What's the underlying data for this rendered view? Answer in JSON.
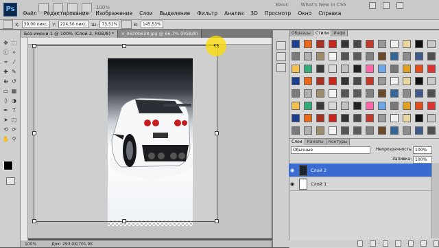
{
  "app": {
    "logo": "Ps",
    "zoom_display": "100%",
    "workspace_items": [
      "Basic",
      "What's New in CS5"
    ]
  },
  "menu": [
    "Файл",
    "Редактирование",
    "Изображение",
    "Слои",
    "Выделение",
    "Фильтр",
    "Анализ",
    "3D",
    "Просмотр",
    "Окно",
    "Справка"
  ],
  "options": {
    "x_label": "X:",
    "x_value": "39,00 пикс.",
    "y_label": "Y:",
    "y_value": "224,50 пикс.",
    "w_label": "Ш:",
    "w_value": "73,51%",
    "h_label": "В:",
    "h_value": "145,53%"
  },
  "tabs": [
    {
      "label": "Без имени-1 @ 100% (Слой 2, RGB/8) *",
      "active": true
    },
    {
      "label": "x_0620b638.jpg @ 66,7% (RGB/8)",
      "active": false
    }
  ],
  "status": {
    "zoom": "100%",
    "doc": "Док: 293,0K/701,9K"
  },
  "styles_panel": {
    "tabs": [
      "Образцы",
      "Стили",
      "Инфо"
    ],
    "active_tab": 1
  },
  "layers_panel": {
    "tabs": [
      "Слои",
      "Каналы",
      "Контуры"
    ],
    "blend_mode": "Обычные",
    "opacity_label": "Непрозрачность:",
    "opacity_value": "100%",
    "fill_label": "Заливка:",
    "fill_value": "100%",
    "layers": [
      {
        "name": "Слой 2",
        "selected": true
      },
      {
        "name": "Слой 1",
        "selected": false
      }
    ]
  },
  "colors": {
    "accent_selected_layer": "#3a6bd1",
    "cursor_highlight": "#ffdc00"
  },
  "icons": [
    "eye-icon",
    "move-tool-icon",
    "marquee-tool-icon",
    "lasso-tool-icon",
    "brush-tool-icon",
    "text-tool-icon"
  ]
}
